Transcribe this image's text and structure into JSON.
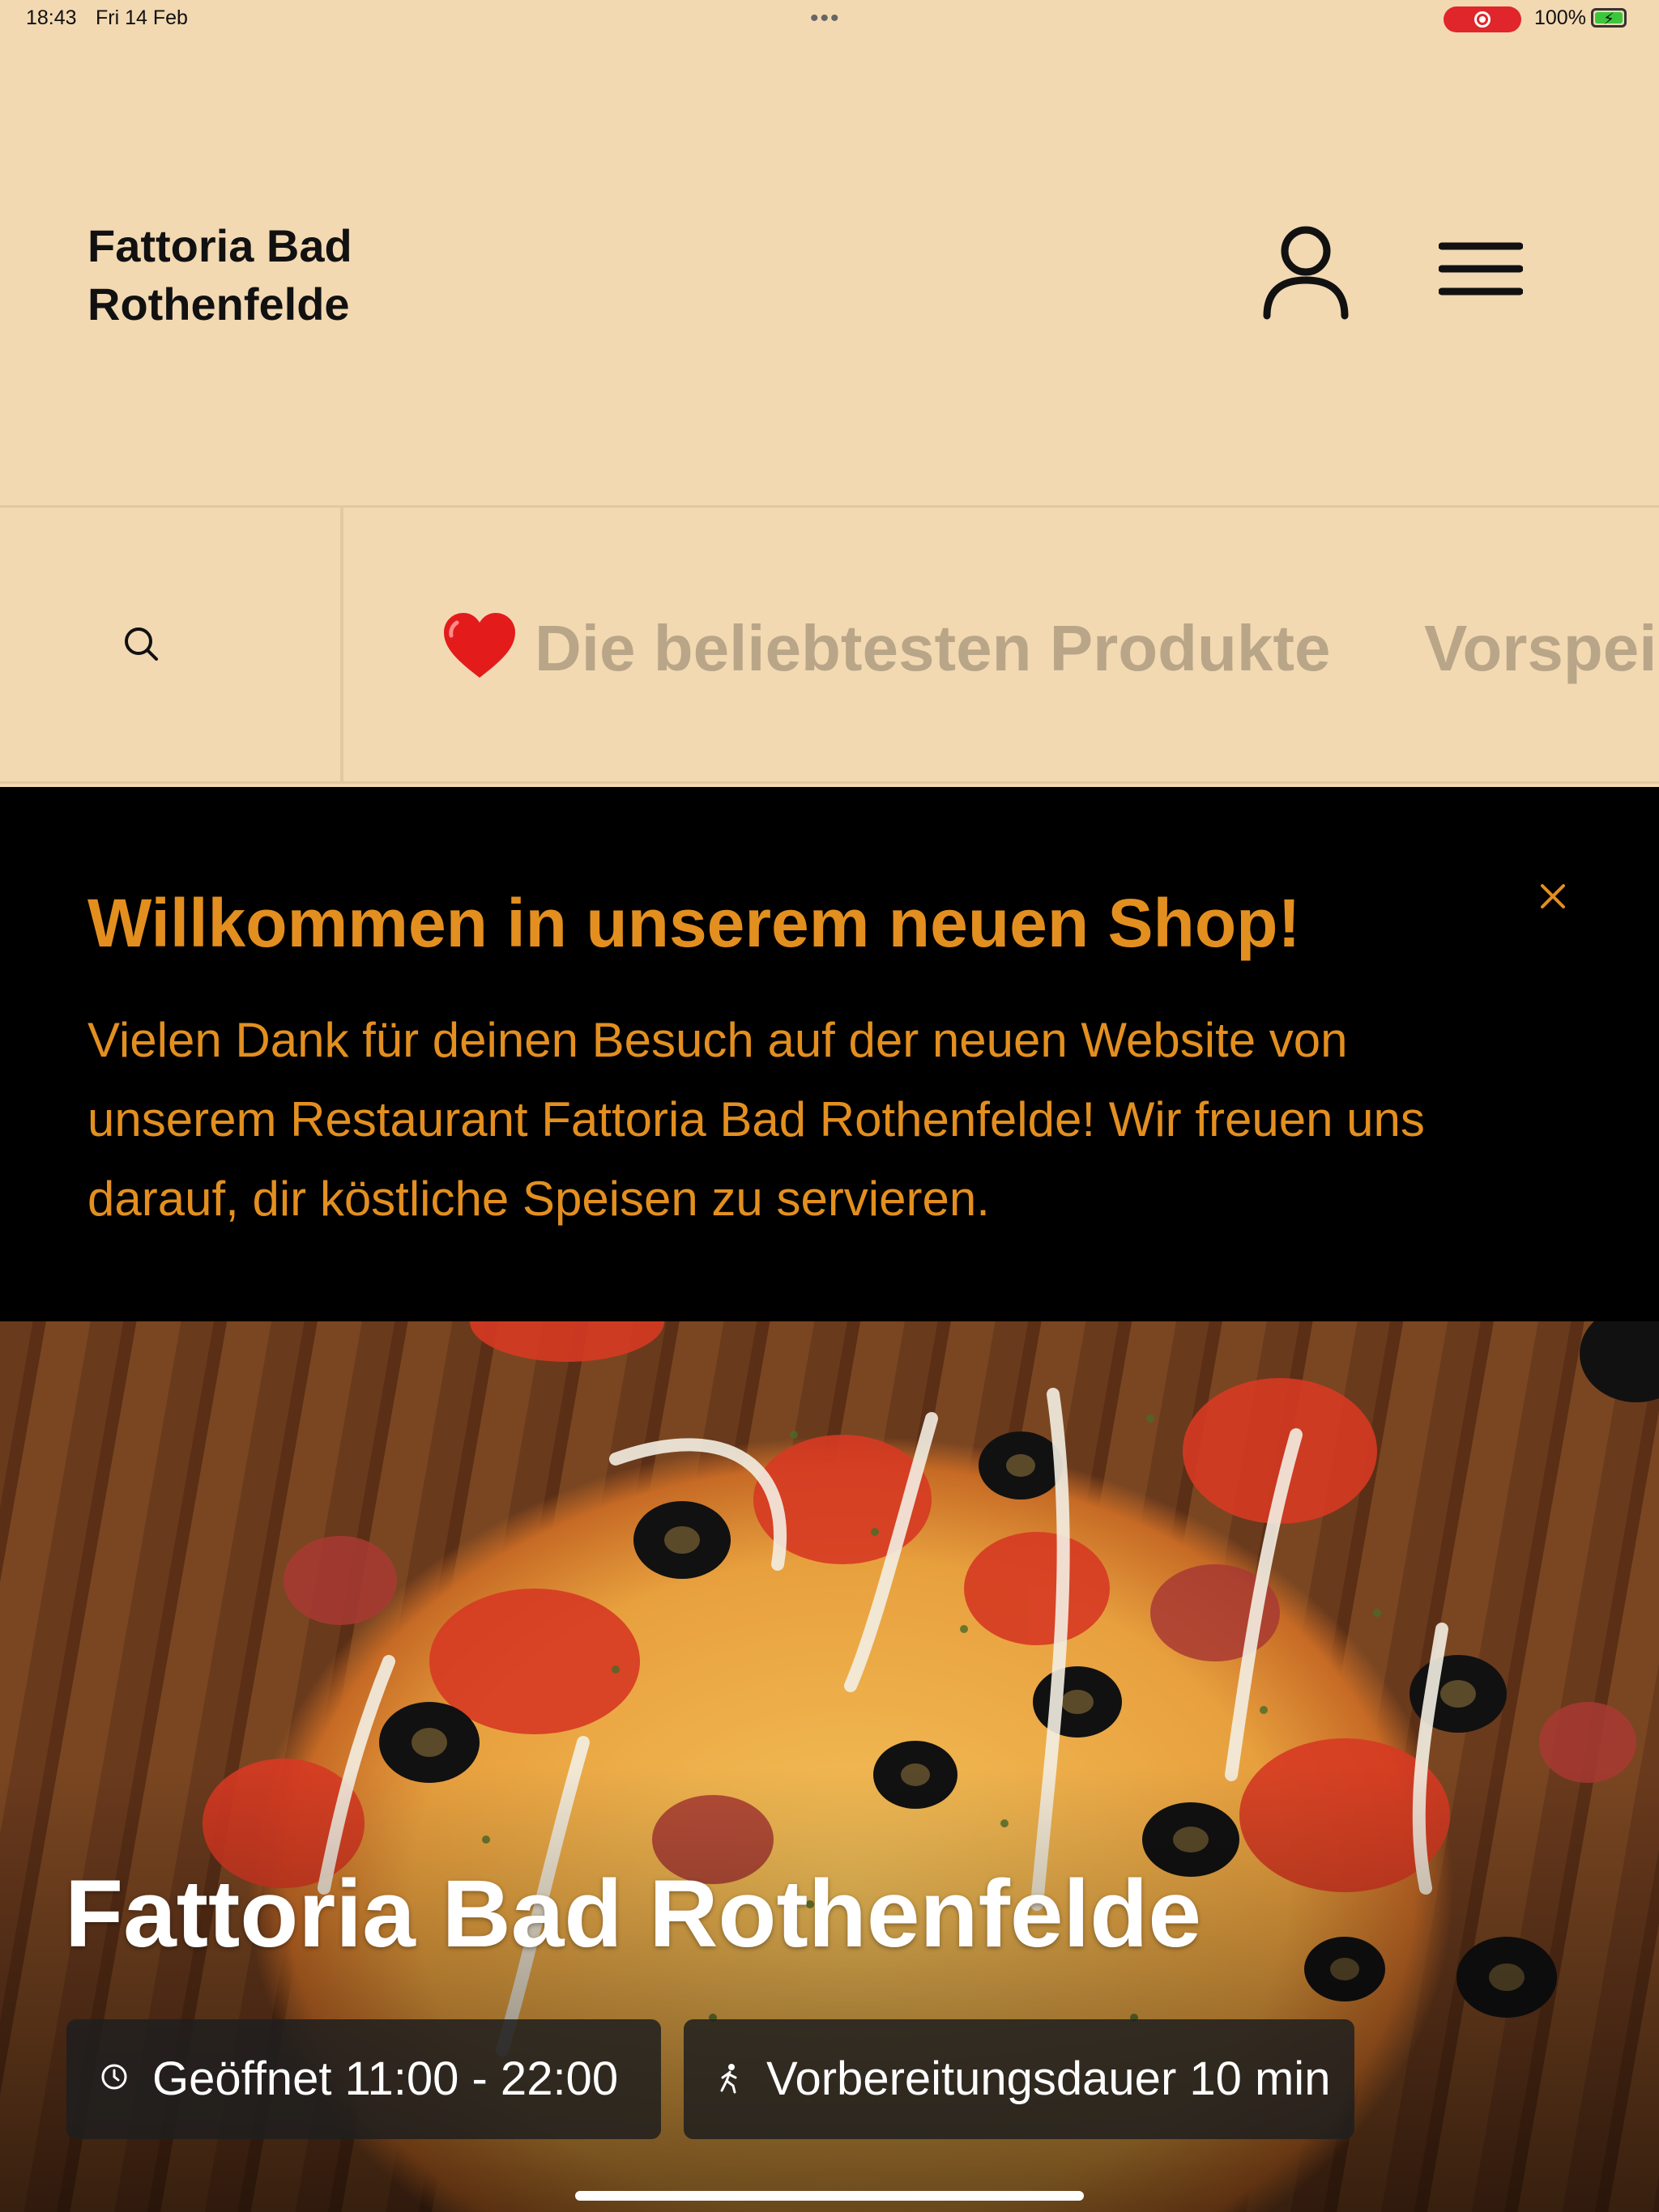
{
  "status_bar": {
    "time": "18:43",
    "date": "Fri 14 Feb",
    "dots": "•••",
    "battery": "100%"
  },
  "header": {
    "brand_line1": "Fattoria Bad",
    "brand_line2": "Rothenfelde",
    "account_icon": "user-icon",
    "menu_icon": "hamburger-icon"
  },
  "category_bar": {
    "search_icon": "search-icon",
    "items": [
      {
        "icon": "heart",
        "label": "Die beliebtesten Produkte"
      },
      {
        "label": "Vorspei"
      }
    ]
  },
  "welcome_banner": {
    "title": "Willkommen in unserem neuen Shop!",
    "text": "Vielen Dank für deinen Besuch auf der neuen Website von unserem Restaurant Fattoria Bad Rothenfelde! Wir freuen uns darauf, dir köstliche Speisen zu servieren.",
    "close_icon": "close-icon",
    "color": "#e38f1f"
  },
  "hero": {
    "title": "Fattoria Bad Rothenfelde",
    "opening_hours": "Geöffnet 11:00 - 22:00",
    "preparation": "Vorbereitungsdauer 10 min"
  },
  "colors": {
    "background": "#f2d9b2",
    "accent": "#e38f1f",
    "category_text": "#b9a587"
  }
}
